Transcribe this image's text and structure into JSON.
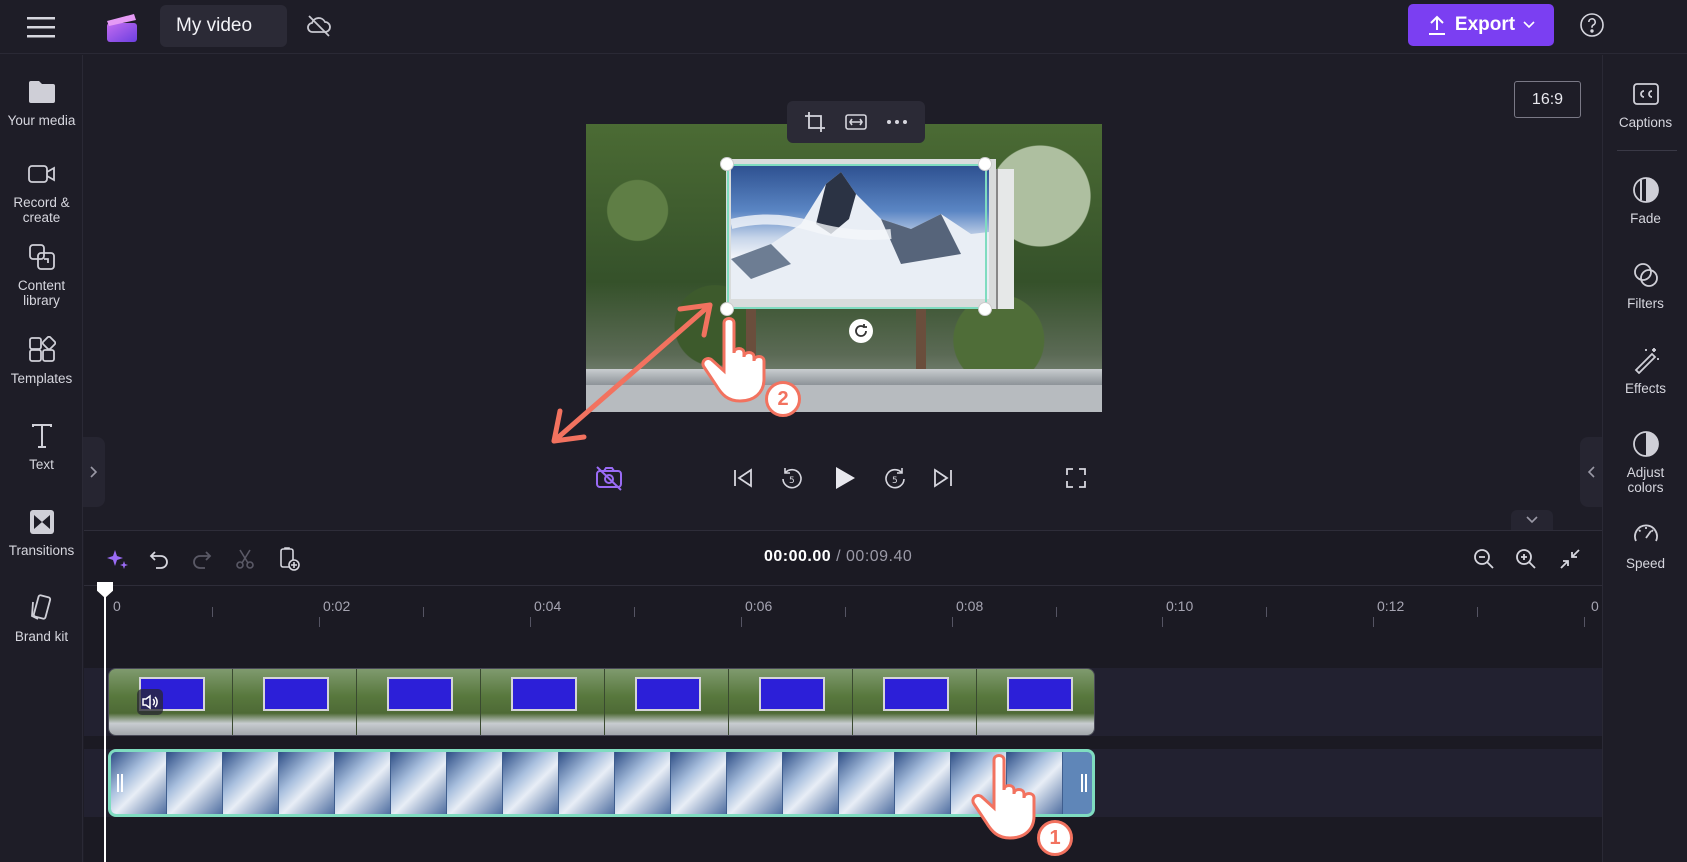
{
  "app": {
    "project_title": "My video",
    "export_label": "Export"
  },
  "left_sidebar": {
    "items": [
      {
        "label": "Your media",
        "icon": "folder-icon"
      },
      {
        "label": "Record &\ncreate",
        "icon": "video-camera-icon"
      },
      {
        "label": "Content\nlibrary",
        "icon": "content-library-icon"
      },
      {
        "label": "Templates",
        "icon": "templates-icon"
      },
      {
        "label": "Text",
        "icon": "text-icon"
      },
      {
        "label": "Transitions",
        "icon": "transitions-icon"
      },
      {
        "label": "Brand kit",
        "icon": "brand-kit-icon"
      }
    ]
  },
  "right_sidebar": {
    "items": [
      {
        "label": "Captions",
        "icon": "captions-icon"
      },
      {
        "label": "Fade",
        "icon": "fade-icon"
      },
      {
        "label": "Filters",
        "icon": "filters-icon"
      },
      {
        "label": "Effects",
        "icon": "effects-icon"
      },
      {
        "label": "Adjust\ncolors",
        "icon": "adjust-colors-icon"
      },
      {
        "label": "Speed",
        "icon": "speed-icon"
      }
    ]
  },
  "preview": {
    "aspect_ratio": "16:9"
  },
  "timeline": {
    "current_time": "00:00.00",
    "separator": " / ",
    "total_time": "00:09.40",
    "ruler_labels": [
      "0",
      "0:02",
      "0:04",
      "0:06",
      "0:08",
      "0:10",
      "0:12",
      "0"
    ]
  },
  "annotations": {
    "step_1": "1",
    "step_2": "2"
  },
  "colors": {
    "accent": "#7b3ff2",
    "selection": "#7fdcc0",
    "annotation_arrow": "#f2725f",
    "background": "#1e1d27"
  }
}
